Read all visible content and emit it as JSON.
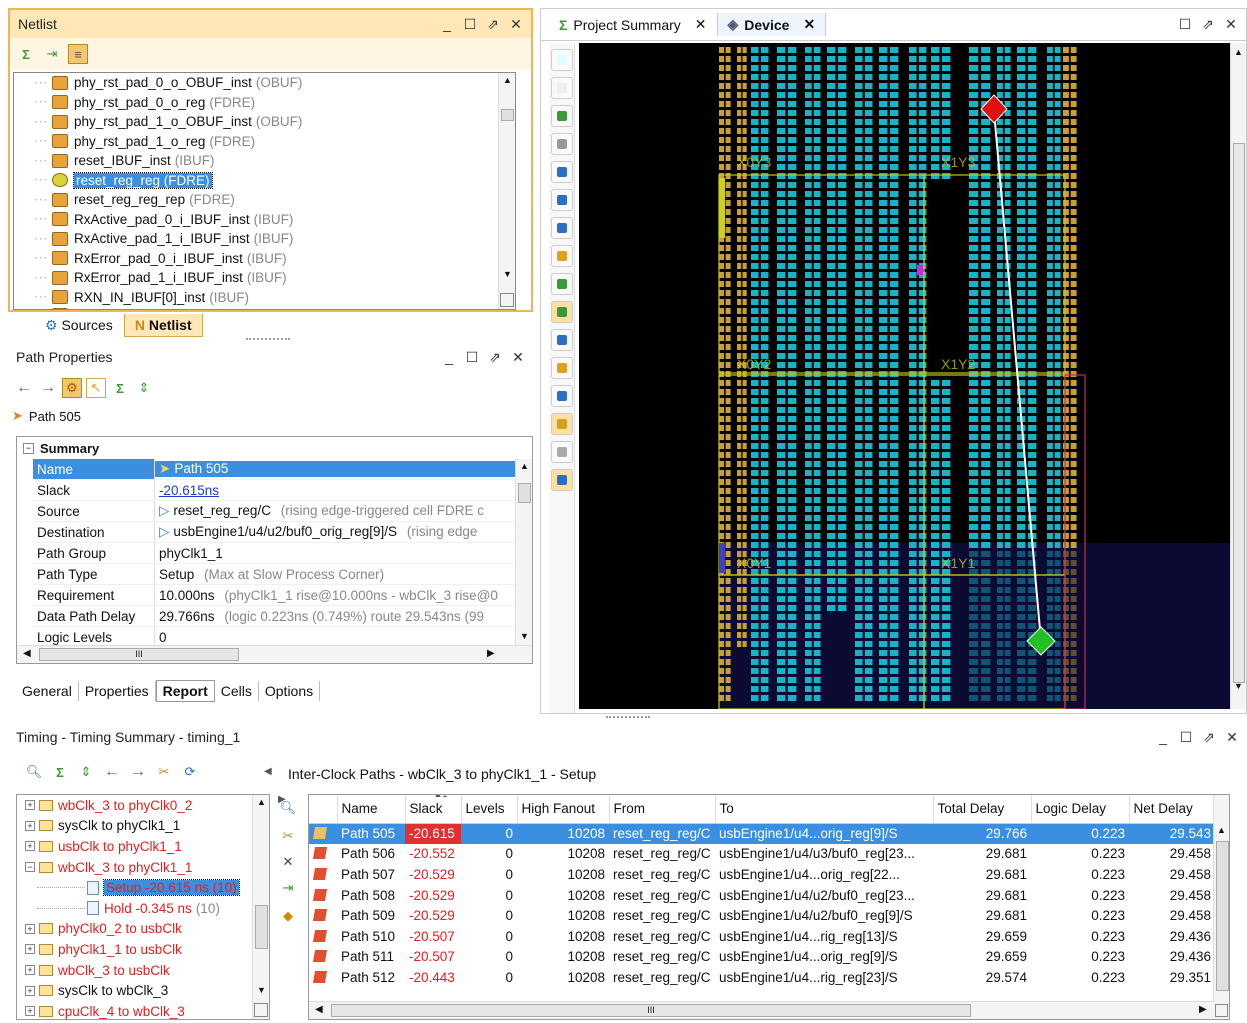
{
  "netlist": {
    "title": "Netlist",
    "items": [
      {
        "name": "phy_rst_pad_0_o_OBUF_inst",
        "type": "(OBUF)"
      },
      {
        "name": "phy_rst_pad_0_o_reg",
        "type": "(FDRE)"
      },
      {
        "name": "phy_rst_pad_1_o_OBUF_inst",
        "type": "(OBUF)"
      },
      {
        "name": "phy_rst_pad_1_o_reg",
        "type": "(FDRE)"
      },
      {
        "name": "reset_IBUF_inst",
        "type": "(IBUF)"
      },
      {
        "name": "reset_reg_reg (FDRE)",
        "type": ""
      },
      {
        "name": "reset_reg_reg_rep",
        "type": "(FDRE)"
      },
      {
        "name": "RxActive_pad_0_i_IBUF_inst",
        "type": "(IBUF)"
      },
      {
        "name": "RxActive_pad_1_i_IBUF_inst",
        "type": "(IBUF)"
      },
      {
        "name": "RxError_pad_0_i_IBUF_inst",
        "type": "(IBUF)"
      },
      {
        "name": "RxError_pad_1_i_IBUF_inst",
        "type": "(IBUF)"
      },
      {
        "name": "RXN_IN_IBUF[0]_inst",
        "type": "(IBUF)"
      }
    ],
    "tabs": {
      "sources": "Sources",
      "netlist": "Netlist"
    }
  },
  "path_properties": {
    "title": "Path Properties",
    "path_label": "Path 505",
    "summary_label": "Summary",
    "rows": [
      {
        "key": "Name",
        "value": "Path 505",
        "extra": ""
      },
      {
        "key": "Slack",
        "value": "-20.615ns",
        "extra": ""
      },
      {
        "key": "Source",
        "value": "reset_reg_reg/C",
        "extra": "(rising edge-triggered cell FDRE c"
      },
      {
        "key": "Destination",
        "value": "usbEngine1/u4/u2/buf0_orig_reg[9]/S",
        "extra": "(rising edge"
      },
      {
        "key": "Path Group",
        "value": "phyClk1_1",
        "extra": ""
      },
      {
        "key": "Path Type",
        "value": "Setup",
        "extra": "(Max at Slow Process Corner)"
      },
      {
        "key": "Requirement",
        "value": "10.000ns",
        "extra": "(phyClk1_1 rise@10.000ns - wbClk_3 rise@0"
      },
      {
        "key": "Data Path Delay",
        "value": "29.766ns",
        "extra": "(logic 0.223ns (0.749%)  route 29.543ns (99"
      },
      {
        "key": "Logic Levels",
        "value": "0",
        "extra": ""
      }
    ],
    "tabs": [
      "General",
      "Properties",
      "Report",
      "Cells",
      "Options"
    ],
    "active_tab": "Report"
  },
  "device": {
    "tabs": [
      {
        "label": "Project Summary",
        "icon": "sigma-icon"
      },
      {
        "label": "Device",
        "icon": "device-icon"
      }
    ],
    "clock_region_labels": [
      "X0Y3",
      "X1Y3",
      "X0Y2",
      "X1Y2",
      "X0Y1",
      "X1Y1"
    ],
    "colors": {
      "background": "#000000",
      "tile": "#17b3c7",
      "source_marker": "#e01010",
      "dest_marker": "#22c022",
      "path_line": "#ffffff",
      "region_border": "#c8c820"
    }
  },
  "timing": {
    "title": "Timing - Timing Summary - timing_1",
    "table_title": "Inter-Clock Paths - wbClk_3 to phyClk1_1 - Setup",
    "tree": [
      {
        "label": "wbClk_3 to phyClk0_2",
        "red": true,
        "indent": 0,
        "expander": "+"
      },
      {
        "label": "sysClk to phyClk1_1",
        "red": false,
        "indent": 0,
        "expander": "+"
      },
      {
        "label": "usbClk to phyClk1_1",
        "red": true,
        "indent": 0,
        "expander": "+"
      },
      {
        "label": "wbClk_3 to phyClk1_1",
        "red": true,
        "indent": 0,
        "expander": "-"
      },
      {
        "label": "Setup -20.615 ns (10)",
        "red": true,
        "indent": 1,
        "expander": "",
        "selected": true
      },
      {
        "label": "Hold -0.345 ns",
        "suffix": "(10)",
        "red": true,
        "indent": 1,
        "expander": ""
      },
      {
        "label": "phyClk0_2 to usbClk",
        "red": true,
        "indent": 0,
        "expander": "+"
      },
      {
        "label": "phyClk1_1 to usbClk",
        "red": true,
        "indent": 0,
        "expander": "+"
      },
      {
        "label": "wbClk_3 to usbClk",
        "red": true,
        "indent": 0,
        "expander": "+"
      },
      {
        "label": "sysClk to wbClk_3",
        "red": false,
        "indent": 0,
        "expander": "+"
      },
      {
        "label": "cpuClk_4 to wbClk_3",
        "red": true,
        "indent": 0,
        "expander": "+"
      }
    ],
    "sort_indicator": "1",
    "columns": [
      "Name",
      "Slack",
      "Levels",
      "High Fanout",
      "From",
      "To",
      "Total Delay",
      "Logic Delay",
      "Net Delay"
    ],
    "rows": [
      [
        "Path 505",
        "-20.615",
        "0",
        "10208",
        "reset_reg_reg/C",
        "usbEngine1/u4...orig_reg[9]/S",
        "29.766",
        "0.223",
        "29.543"
      ],
      [
        "Path 506",
        "-20.552",
        "0",
        "10208",
        "reset_reg_reg/C",
        "usbEngine1/u4/u3/buf0_reg[23...",
        "29.681",
        "0.223",
        "29.458"
      ],
      [
        "Path 507",
        "-20.529",
        "0",
        "10208",
        "reset_reg_reg/C",
        "usbEngine1/u4...orig_reg[22...",
        "29.681",
        "0.223",
        "29.458"
      ],
      [
        "Path 508",
        "-20.529",
        "0",
        "10208",
        "reset_reg_reg/C",
        "usbEngine1/u4/u2/buf0_reg[23...",
        "29.681",
        "0.223",
        "29.458"
      ],
      [
        "Path 509",
        "-20.529",
        "0",
        "10208",
        "reset_reg_reg/C",
        "usbEngine1/u4/u2/buf0_reg[9]/S",
        "29.681",
        "0.223",
        "29.458"
      ],
      [
        "Path 510",
        "-20.507",
        "0",
        "10208",
        "reset_reg_reg/C",
        "usbEngine1/u4...rig_reg[13]/S",
        "29.659",
        "0.223",
        "29.436"
      ],
      [
        "Path 511",
        "-20.507",
        "0",
        "10208",
        "reset_reg_reg/C",
        "usbEngine1/u4...orig_reg[9]/S",
        "29.659",
        "0.223",
        "29.436"
      ],
      [
        "Path 512",
        "-20.443",
        "0",
        "10208",
        "reset_reg_reg/C",
        "usbEngine1/u4...rig_reg[23]/S",
        "29.574",
        "0.223",
        "29.351"
      ]
    ]
  }
}
